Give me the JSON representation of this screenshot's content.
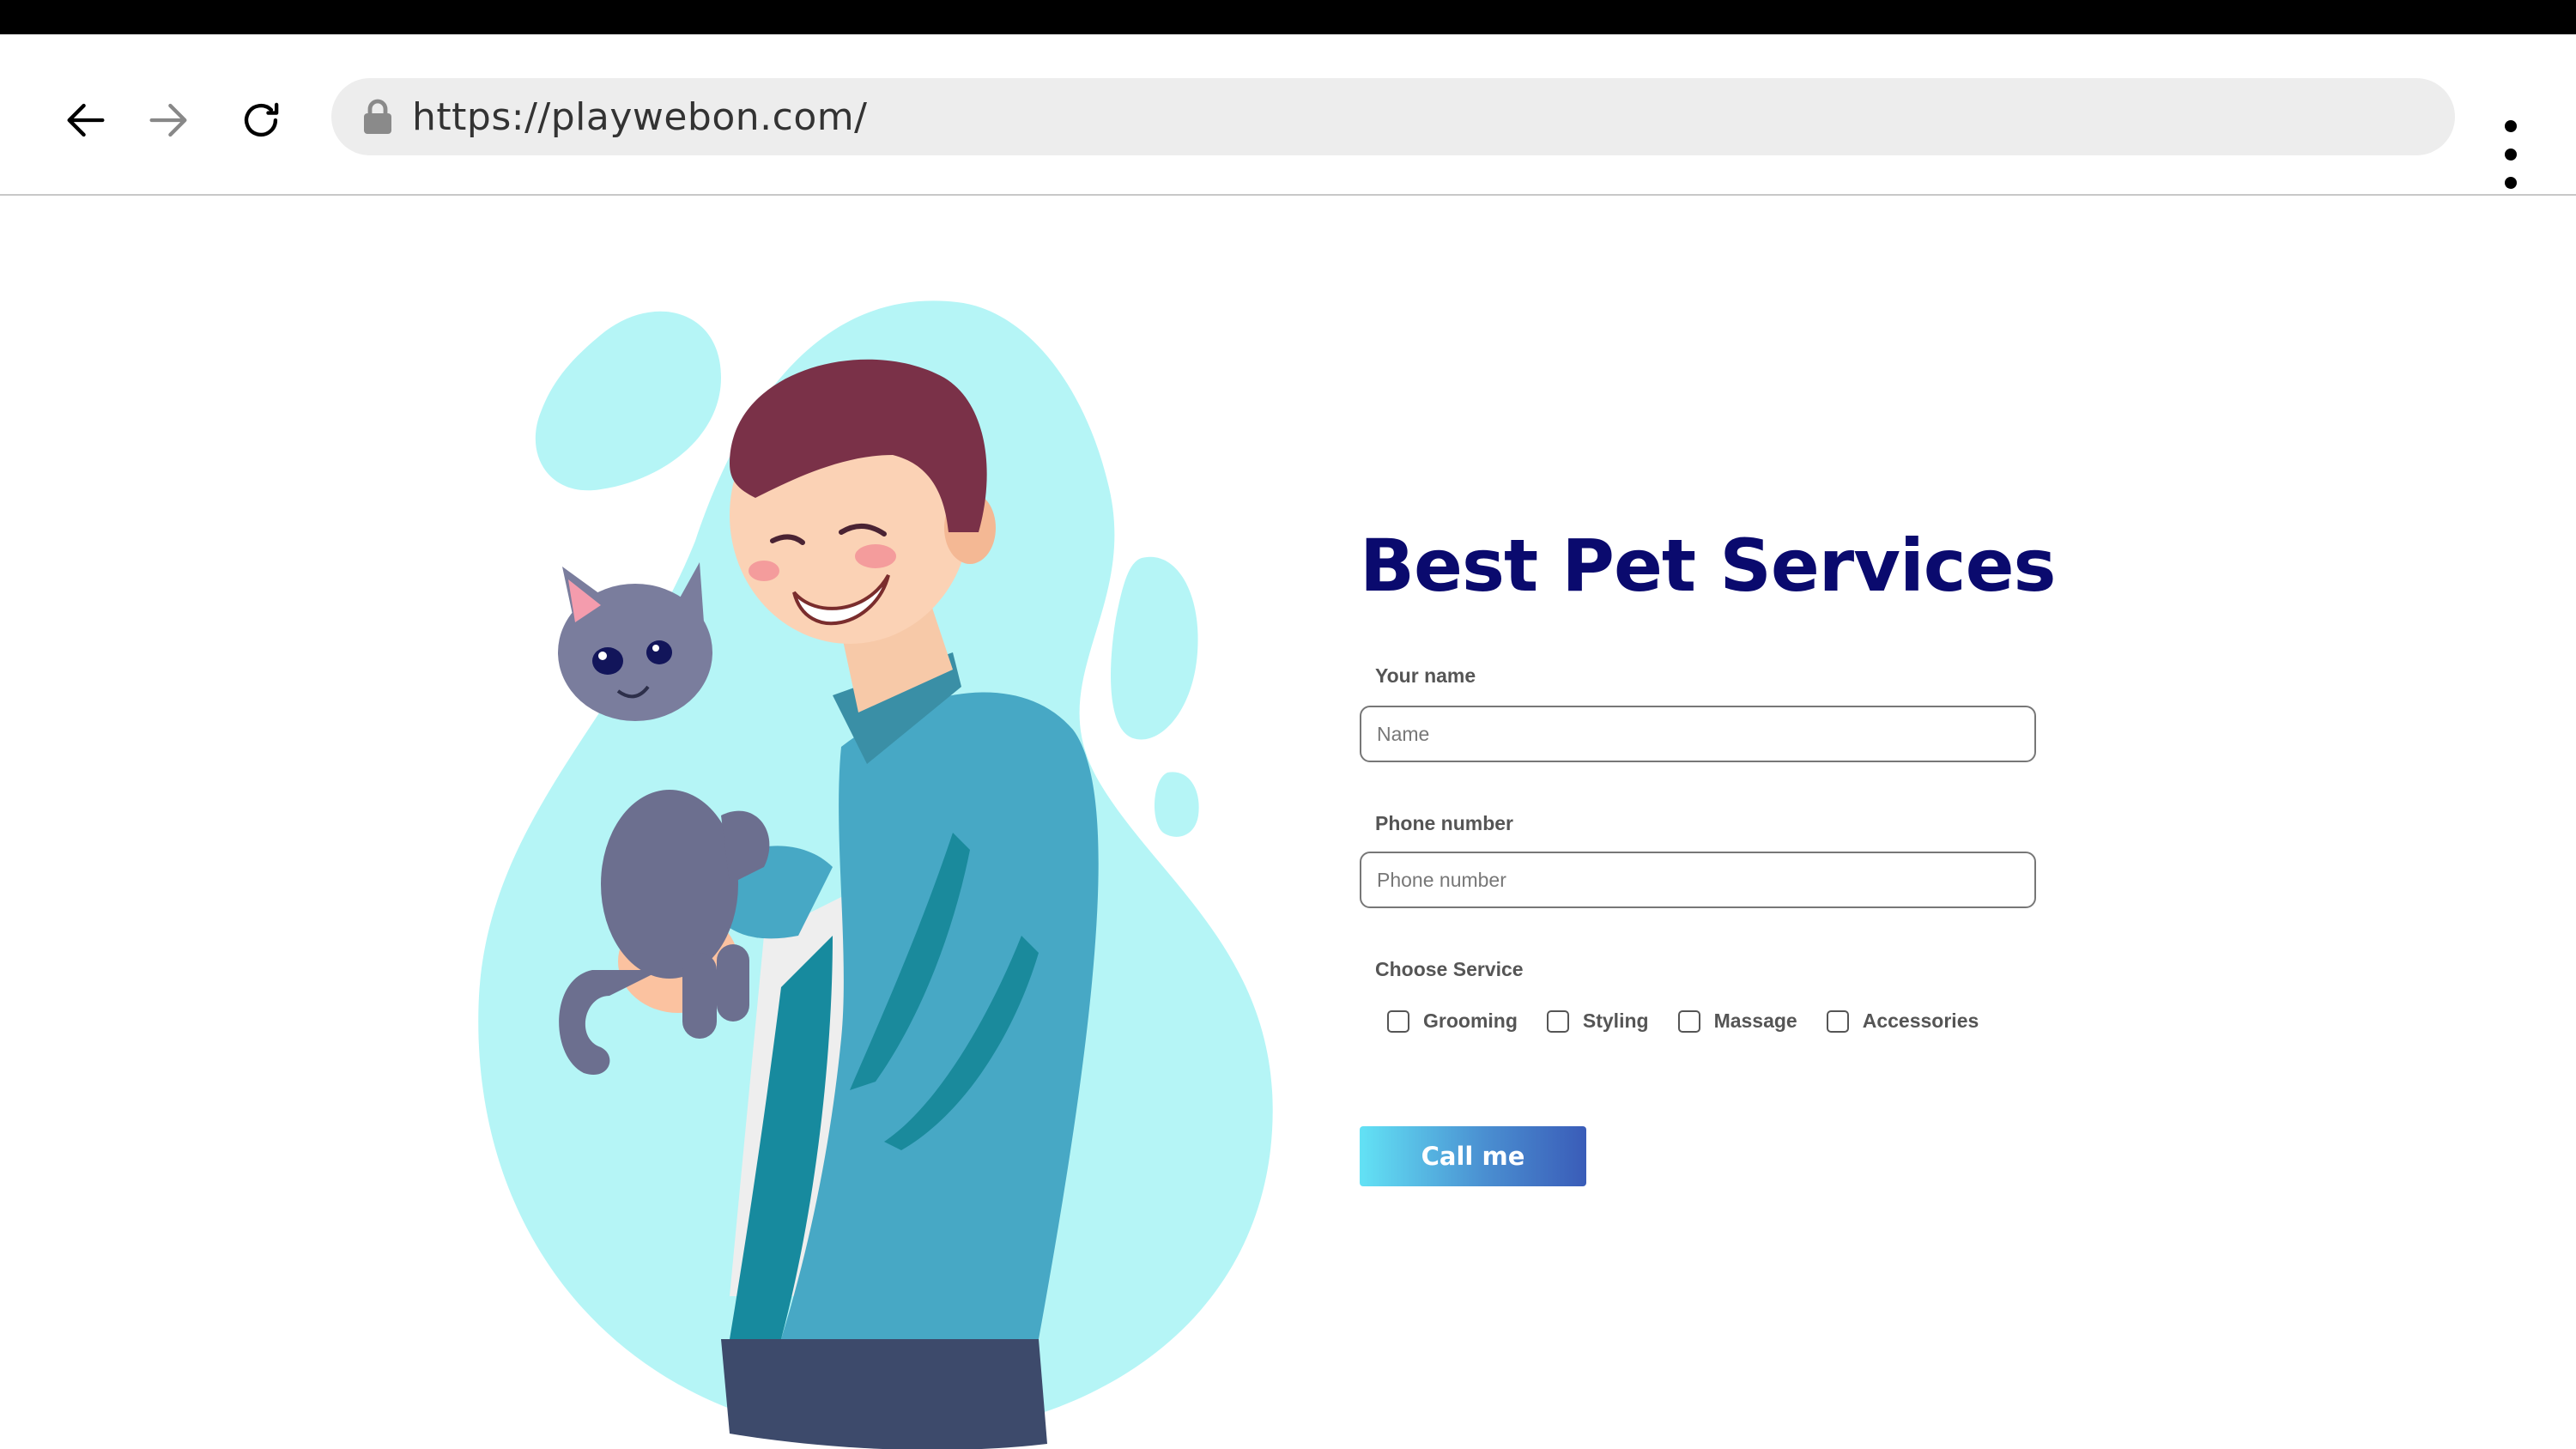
{
  "browser": {
    "url": "https://playwebon.com/",
    "back_icon": "arrow-left-icon",
    "forward_icon": "arrow-right-icon",
    "reload_icon": "reload-icon",
    "lock_icon": "lock-icon",
    "menu_icon": "vertical-dots-icon"
  },
  "page": {
    "title": "Best Pet Services",
    "illustration": "man-holding-cat-illustration",
    "form": {
      "name_label": "Your name",
      "name_placeholder": "Name",
      "phone_label": "Phone number",
      "phone_placeholder": "Phone number",
      "service_label": "Choose Service",
      "services": [
        {
          "label": "Grooming",
          "checked": false
        },
        {
          "label": "Styling",
          "checked": false
        },
        {
          "label": "Massage",
          "checked": false
        },
        {
          "label": "Accessories",
          "checked": false
        }
      ],
      "submit_label": "Call me"
    }
  },
  "colors": {
    "title": "#0a0a6e",
    "blob": "#b5f5f6",
    "button_gradient_start": "#63e2f5",
    "button_gradient_end": "#3a5cb8"
  }
}
